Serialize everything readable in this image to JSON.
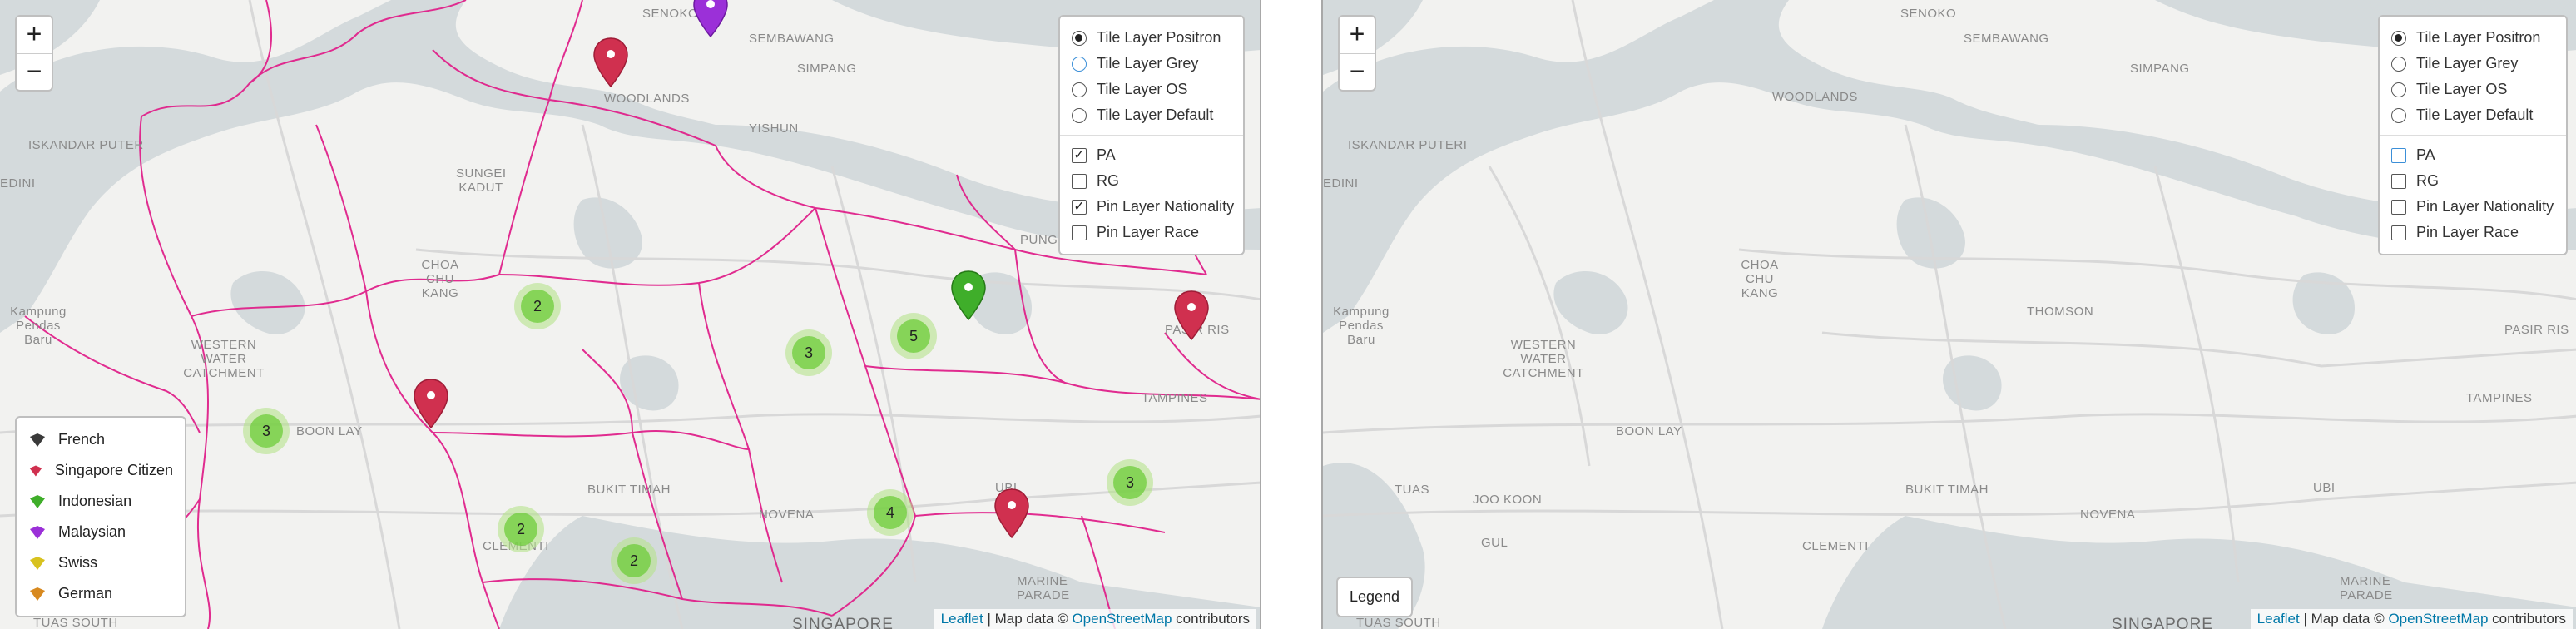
{
  "left_map": {
    "zoom": {
      "in_label": "+",
      "out_label": "−"
    },
    "places": {
      "iskandar": "ISKANDAR PUTER",
      "edini": "EDINI",
      "woodlands": "WOODLANDS",
      "yishun": "YISHUN",
      "senoko": "SENOKO",
      "sembawang": "SEMBAWANG",
      "simpang": "SIMPANG",
      "sungei_kadut": "SUNGEI KADUT",
      "choa_chu_kang": "CHOA CHU KANG",
      "punggol": "PUNGGOL",
      "kampung": "Kampung Pendas Baru",
      "western": "WESTERN WATER CATCHMENT",
      "pasir_ris": "PASIR RIS",
      "tampines": "TAMPINES",
      "boon_lay": "BOON LAY",
      "bukit_timah": "BUKIT TIMAH",
      "clementi": "CLEMENTI",
      "novena": "NOVENA",
      "ubi": "UBI",
      "marine_parade": "MARINE PARADE",
      "tuas_south": "TUAS SOUTH",
      "singapore": "SINGAPORE"
    },
    "layers": {
      "base": [
        "Tile Layer Positron",
        "Tile Layer Grey",
        "Tile Layer OS",
        "Tile Layer Default"
      ],
      "base_selected": 0,
      "overlays": [
        "PA",
        "RG",
        "Pin Layer Nationality",
        "Pin Layer Race"
      ],
      "overlays_checked": [
        true,
        false,
        true,
        false
      ],
      "check_mark": "✓"
    },
    "clusters": [
      "2",
      "3",
      "5",
      "3",
      "2",
      "2",
      "4",
      "3"
    ],
    "legend": {
      "items": [
        {
          "label": "French",
          "color": "#3a3a3a"
        },
        {
          "label": "Singapore Citizen",
          "color": "#d0304f"
        },
        {
          "label": "Indonesian",
          "color": "#3fae2a"
        },
        {
          "label": "Malaysian",
          "color": "#9b30d8"
        },
        {
          "label": "Swiss",
          "color": "#d8c21f"
        },
        {
          "label": "German",
          "color": "#d8891f"
        }
      ]
    },
    "attribution": {
      "leaflet": "Leaflet",
      "sep": " | Map data © ",
      "osm": "OpenStreetMap",
      "tail": " contributors"
    }
  },
  "right_map": {
    "zoom": {
      "in_label": "+",
      "out_label": "−"
    },
    "places": {
      "iskandar": "ISKANDAR PUTERI",
      "edini": "EDINI",
      "woodlands": "WOODLANDS",
      "senoko": "SENOKO",
      "sembawang": "SEMBAWANG",
      "simpang": "SIMPANG",
      "choa_chu_kang": "CHOA CHU KANG",
      "thomson": "THOMSON",
      "kampung": "Kampung Pendas Baru",
      "western": "WESTERN WATER CATCHMENT",
      "pasir_ris": "PASIR RIS",
      "tampines": "TAMPINES",
      "boon_lay": "BOON LAY",
      "tuas": "TUAS",
      "joo_koon": "JOO KOON",
      "gul": "GUL",
      "bukit_timah": "BUKIT TIMAH",
      "clementi": "CLEMENTI",
      "novena": "NOVENA",
      "ubi": "UBI",
      "marine_parade": "MARINE PARADE",
      "tuas_south": "TUAS SOUTH",
      "singapore": "SINGAPORE"
    },
    "layers": {
      "base": [
        "Tile Layer Positron",
        "Tile Layer Grey",
        "Tile Layer OS",
        "Tile Layer Default"
      ],
      "base_selected": 0,
      "overlays": [
        "PA",
        "RG",
        "Pin Layer Nationality",
        "Pin Layer Race"
      ],
      "overlays_checked": [
        false,
        false,
        false,
        false
      ]
    },
    "legend_button": "Legend",
    "attribution": {
      "leaflet": "Leaflet",
      "sep": " | Map data © ",
      "osm": "OpenStreetMap",
      "tail": " contributors"
    }
  },
  "colors": {
    "land": "#f2f2f0",
    "water": "#d4dadc",
    "boundary": "#e0218a",
    "cluster_outer": "#b5e28c",
    "cluster_inner": "#6ecc39"
  }
}
